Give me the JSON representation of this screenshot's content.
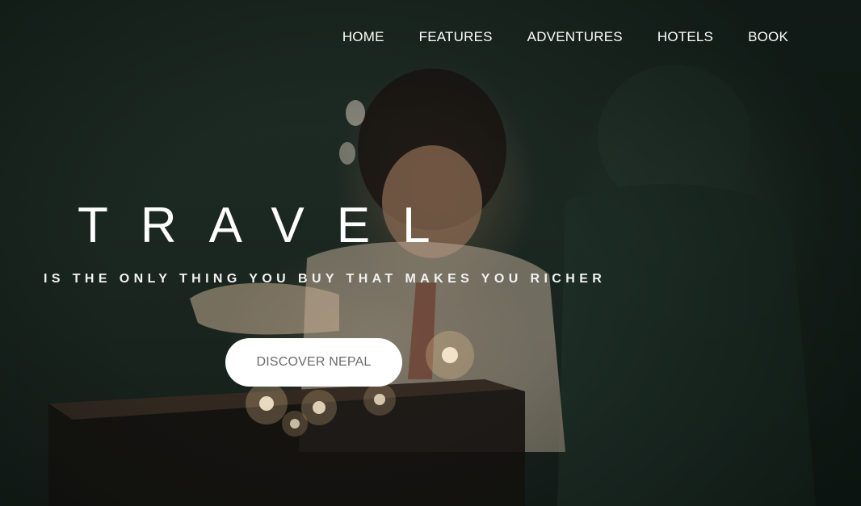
{
  "nav": {
    "items": [
      {
        "label": "HOME"
      },
      {
        "label": "FEATURES"
      },
      {
        "label": "ADVENTURES"
      },
      {
        "label": "HOTELS"
      },
      {
        "label": "BOOK"
      }
    ]
  },
  "hero": {
    "title": "TRAVEL",
    "tagline": "IS THE ONLY THING YOU BUY THAT MAKES YOU RICHER",
    "cta_label": "DISCOVER NEPAL",
    "background_image": "photo of a child lighting oil lamps / candles in a dark room"
  },
  "colors": {
    "text": "#ffffff",
    "button_bg": "#ffffff",
    "button_text": "#6b6b6b",
    "overlay": "#1b2721"
  }
}
